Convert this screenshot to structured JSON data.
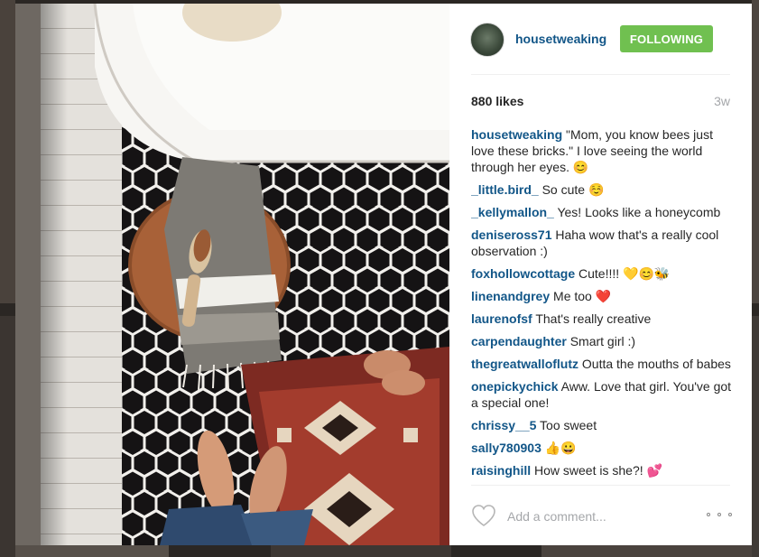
{
  "post": {
    "username": "housetweaking",
    "follow_label": "FOLLOWING",
    "likes": "880 likes",
    "time": "3w",
    "comment_placeholder": "Add a comment..."
  },
  "comments": [
    {
      "user": "housetweaking",
      "text": "\"Mom, you know bees just love these bricks.\" I love seeing the world through her eyes. ",
      "emoji": "😊"
    },
    {
      "user": "_little.bird_",
      "text": "So cute ",
      "emoji": "☺️"
    },
    {
      "user": "_kellymallon_",
      "text": "Yes! Looks like a honeycomb",
      "emoji": ""
    },
    {
      "user": "deniseross71",
      "text": "Haha wow that's a really cool observation :)",
      "emoji": ""
    },
    {
      "user": "foxhollowcottage",
      "text": "Cute!!!! ",
      "emoji": "💛😊🐝"
    },
    {
      "user": "linenandgrey",
      "text": "Me too ",
      "emoji": "❤️"
    },
    {
      "user": "laurenofsf",
      "text": "That's really creative",
      "emoji": ""
    },
    {
      "user": "carpendaughter",
      "text": "Smart girl :)",
      "emoji": ""
    },
    {
      "user": "thegreatwalloflutz",
      "text": "Outta the mouths of babes",
      "emoji": ""
    },
    {
      "user": "onepickychick",
      "text": "Aww. Love that girl. You've got a special one!",
      "emoji": ""
    },
    {
      "user": "chrissy__5",
      "text": "Too sweet",
      "emoji": ""
    },
    {
      "user": "sally780903",
      "text": "",
      "emoji": "👍😀"
    },
    {
      "user": "raisinghill",
      "text": "How sweet is she?! ",
      "emoji": "💕"
    }
  ],
  "colors": {
    "link": "#125688",
    "follow_button": "#70c050"
  },
  "icons": {
    "like": "heart-outline-icon",
    "more": "ellipsis-icon"
  }
}
